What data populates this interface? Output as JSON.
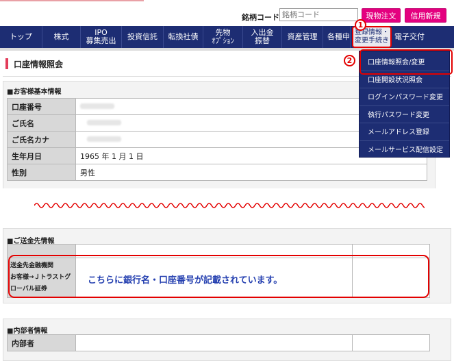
{
  "search": {
    "label": "銘柄コード",
    "placeholder": "銘柄コード"
  },
  "buttons": {
    "genbutsu": "現物注文",
    "shinyo": "信用新規"
  },
  "nav": [
    {
      "label": "トップ"
    },
    {
      "label": "株式"
    },
    {
      "label": "IPO\n募集売出"
    },
    {
      "label": "投資信託"
    },
    {
      "label": "転換社債"
    },
    {
      "label": "先物\nｵﾌﾟｼｮﾝ"
    },
    {
      "label": "入出金\n振替"
    },
    {
      "label": "資産管理"
    },
    {
      "label": "各種申"
    },
    {
      "label": "登録情報・\n変更手続き"
    },
    {
      "label": "電子交付"
    }
  ],
  "page_title": "口座情報照会",
  "basic": {
    "heading": "■お客様基本情報",
    "rows": [
      {
        "label": "口座番号",
        "value": ""
      },
      {
        "label": "ご氏名",
        "value": ""
      },
      {
        "label": "ご氏名カナ",
        "value": ""
      },
      {
        "label": "生年月日",
        "value": "1965 年 1 月 1 日"
      },
      {
        "label": "性別",
        "value": "男性"
      }
    ]
  },
  "dropdown": [
    "口座情報照会/変更",
    "口座開設状況照会",
    "ログインパスワード変更",
    "執行パスワード変更",
    "メールアドレス登録",
    "メールサービス配信設定"
  ],
  "markers": {
    "one": "1",
    "two": "2"
  },
  "remit": {
    "heading": "■ご送金先情報",
    "label": "送金先金融機関\nお客様→Ｊトラストグローバル証券",
    "note": "こちらに銀行名・口座番号が記載されています。"
  },
  "insider": {
    "heading": "■内部者情報",
    "label": "内部者"
  }
}
